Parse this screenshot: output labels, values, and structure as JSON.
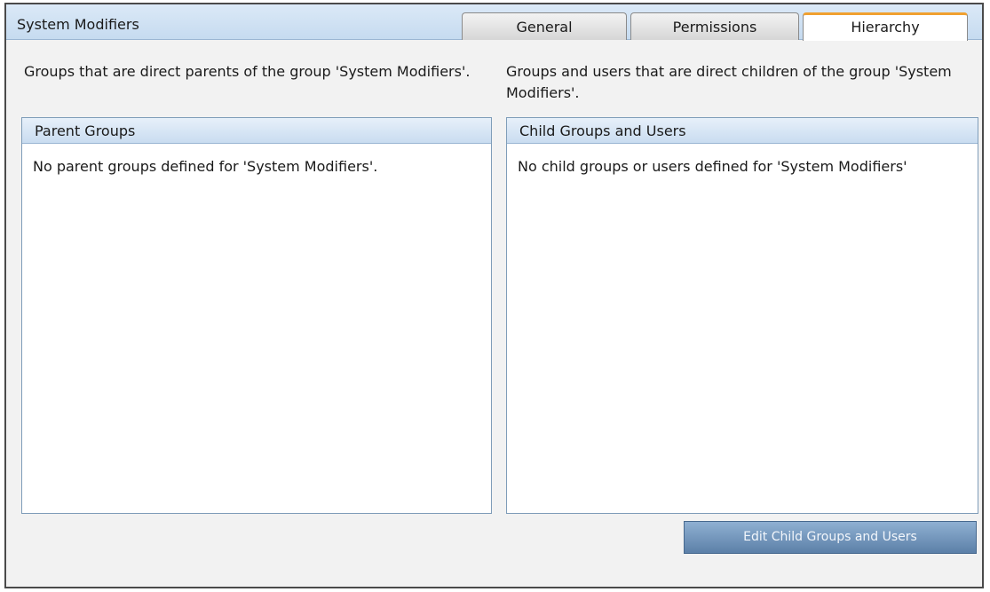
{
  "header": {
    "title": "System Modifiers"
  },
  "tabs": [
    {
      "label": "General",
      "active": false
    },
    {
      "label": "Permissions",
      "active": false
    },
    {
      "label": "Hierarchy",
      "active": true
    }
  ],
  "left": {
    "description": "Groups that are direct parents of the group 'System Modifiers'.",
    "panel_title": "Parent Groups",
    "empty_message": "No parent groups defined for 'System Modifiers'."
  },
  "right": {
    "description": "Groups and users that are direct children of the group 'System Modifiers'.",
    "panel_title": "Child Groups and Users",
    "empty_message": "No child groups or users defined for 'System Modifiers'"
  },
  "actions": {
    "edit_children_label": "Edit Child Groups and Users"
  },
  "colors": {
    "active_tab_accent": "#f0a030",
    "header_blue": "#c6dbf0",
    "button_blue": "#5c80a8"
  }
}
